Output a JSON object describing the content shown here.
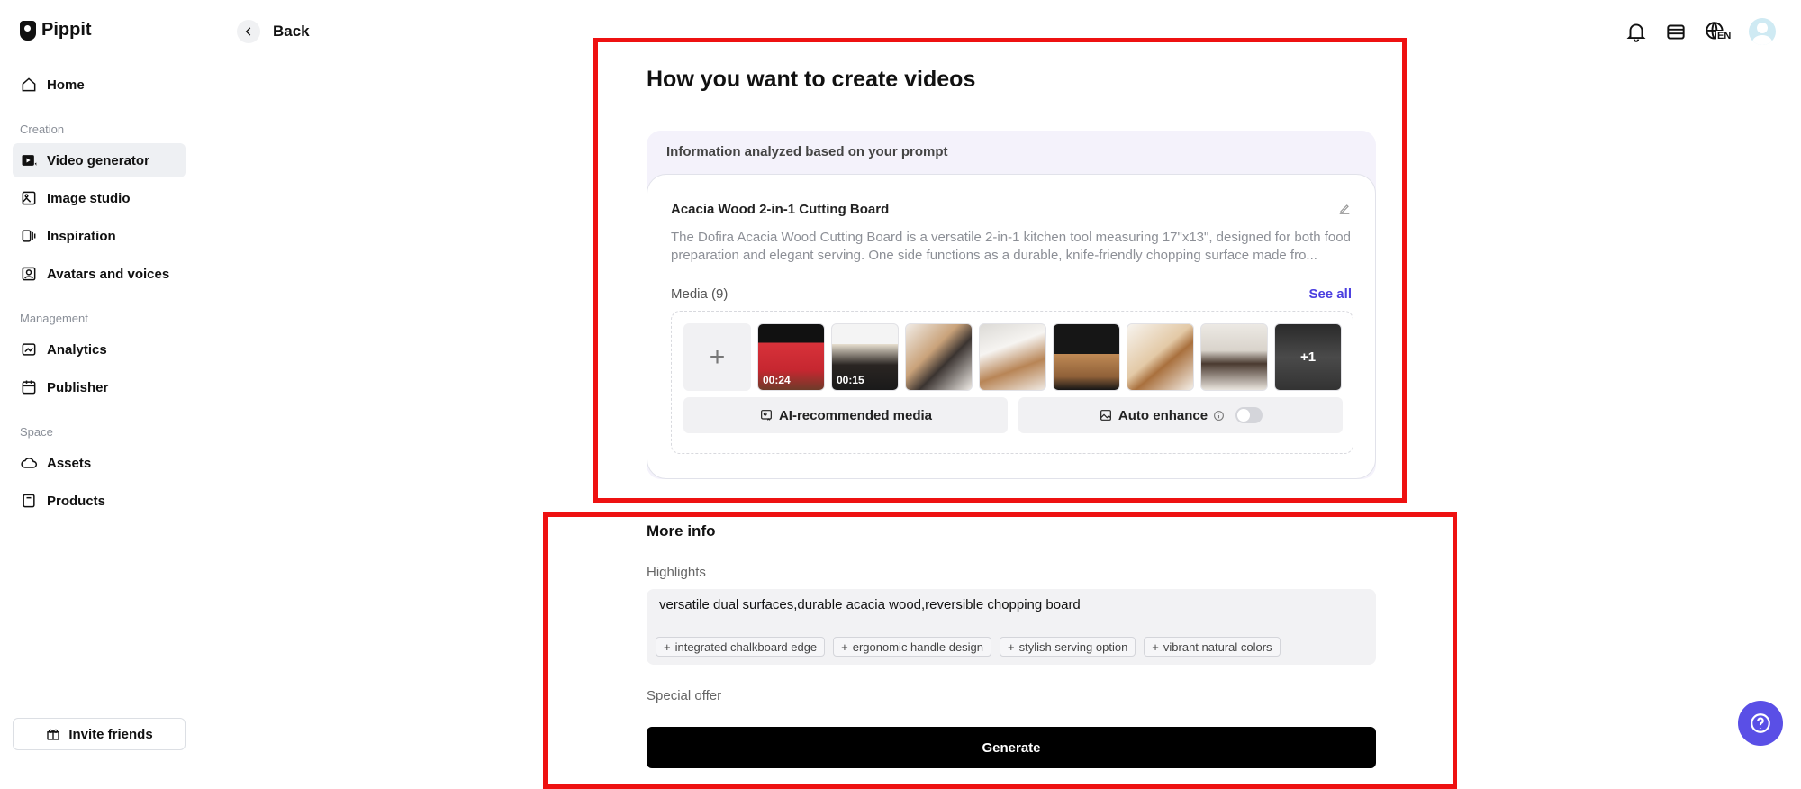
{
  "app": {
    "name": "Pippit"
  },
  "back": {
    "label": "Back"
  },
  "sidebar": {
    "home": "Home",
    "section_creation": "Creation",
    "video_generator": "Video generator",
    "image_studio": "Image studio",
    "inspiration": "Inspiration",
    "avatars_voices": "Avatars and voices",
    "section_management": "Management",
    "analytics": "Analytics",
    "publisher": "Publisher",
    "section_space": "Space",
    "assets": "Assets",
    "products": "Products",
    "invite": "Invite friends"
  },
  "header": {
    "language": "EN"
  },
  "main": {
    "title": "How you want to create videos",
    "info_caption": "Information analyzed based on your prompt",
    "product_name": "Acacia Wood 2-in-1 Cutting Board",
    "product_desc": "The Dofira Acacia Wood Cutting Board is a versatile 2-in-1 kitchen tool measuring 17\"x13\", designed for both food preparation and elegant serving. One side functions as a durable, knife-friendly chopping surface made fro...",
    "media_label": "Media (9)",
    "see_all": "See all",
    "media": [
      {
        "duration": "00:24"
      },
      {
        "duration": "00:15"
      },
      {
        "duration": ""
      },
      {
        "duration": ""
      },
      {
        "duration": ""
      },
      {
        "duration": ""
      },
      {
        "duration": ""
      },
      {
        "more": "+1"
      }
    ],
    "ai_media": "AI-recommended media",
    "auto_enhance": "Auto enhance",
    "auto_enhance_on": false
  },
  "more_info": {
    "title": "More info",
    "highlights_label": "Highlights",
    "highlights_value": "versatile dual surfaces,durable acacia wood,reversible chopping board",
    "chips": [
      "integrated chalkboard edge",
      "ergonomic handle design",
      "stylish serving option",
      "vibrant natural colors"
    ],
    "special_offer_label": "Special offer",
    "generate": "Generate"
  },
  "colors": {
    "accent": "#4b3fe0",
    "help": "#5a4fe6",
    "annotation": "#ee1111"
  }
}
